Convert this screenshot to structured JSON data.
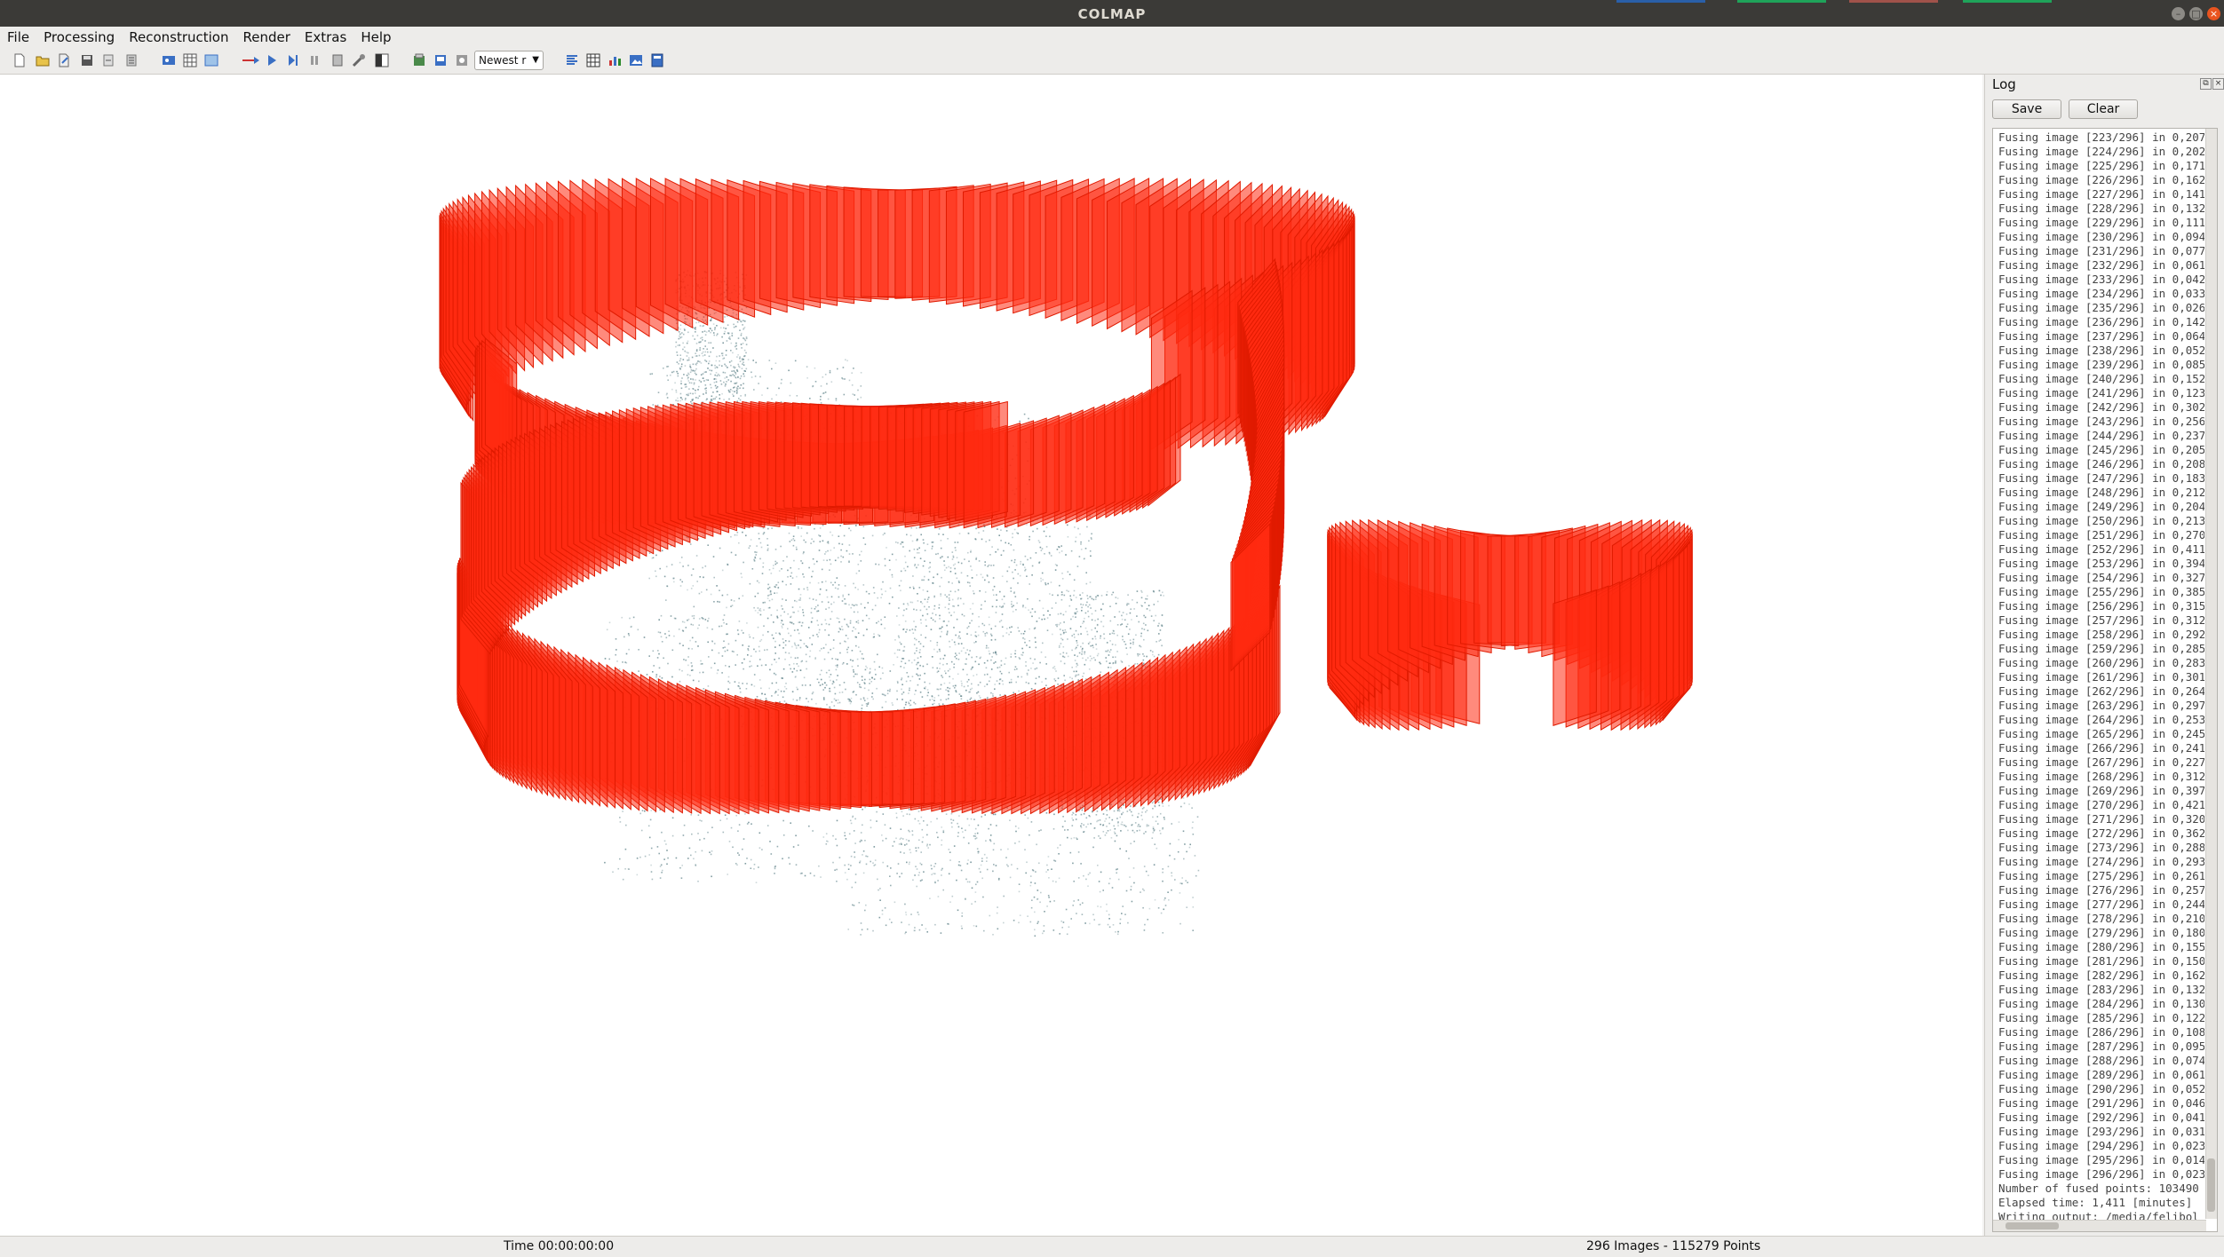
{
  "window": {
    "title": "COLMAP",
    "controls": [
      "minimize-icon",
      "maximize-icon",
      "close-icon"
    ]
  },
  "menu": [
    "File",
    "Processing",
    "Reconstruction",
    "Render",
    "Extras",
    "Help"
  ],
  "toolbar": {
    "icons": [
      "new-project-icon",
      "open-project-icon",
      "edit-project-icon",
      "save-project-icon",
      "import-model-icon",
      "export-model-icon",
      "feature-extraction-icon",
      "feature-matching-icon",
      "database-icon",
      "reconstruction-start-icon",
      "play-icon",
      "step-icon",
      "pause-icon",
      "reset-icon",
      "bundle-adjustment-icon",
      "dense-icon",
      "render-options-icon",
      "reconstruction-stats-icon",
      "match-matrix-icon"
    ],
    "reconstruction_select": "Newest r",
    "right_icons": [
      "log-icon",
      "grid-icon",
      "chart-icon",
      "image-icon",
      "window-icon"
    ]
  },
  "log": {
    "title": "Log",
    "save_label": "Save",
    "clear_label": "Clear",
    "lines": [
      "Fusing image [223/296] in 0,207",
      "Fusing image [224/296] in 0,202",
      "Fusing image [225/296] in 0,171",
      "Fusing image [226/296] in 0,162",
      "Fusing image [227/296] in 0,141",
      "Fusing image [228/296] in 0,132",
      "Fusing image [229/296] in 0,111",
      "Fusing image [230/296] in 0,094",
      "Fusing image [231/296] in 0,077",
      "Fusing image [232/296] in 0,061",
      "Fusing image [233/296] in 0,042",
      "Fusing image [234/296] in 0,033",
      "Fusing image [235/296] in 0,026",
      "Fusing image [236/296] in 0,142",
      "Fusing image [237/296] in 0,064",
      "Fusing image [238/296] in 0,052",
      "Fusing image [239/296] in 0,085",
      "Fusing image [240/296] in 0,152",
      "Fusing image [241/296] in 0,123",
      "Fusing image [242/296] in 0,302",
      "Fusing image [243/296] in 0,256",
      "Fusing image [244/296] in 0,237",
      "Fusing image [245/296] in 0,205",
      "Fusing image [246/296] in 0,208",
      "Fusing image [247/296] in 0,183",
      "Fusing image [248/296] in 0,212",
      "Fusing image [249/296] in 0,204",
      "Fusing image [250/296] in 0,213",
      "Fusing image [251/296] in 0,270",
      "Fusing image [252/296] in 0,411",
      "Fusing image [253/296] in 0,394",
      "Fusing image [254/296] in 0,327",
      "Fusing image [255/296] in 0,385",
      "Fusing image [256/296] in 0,315",
      "Fusing image [257/296] in 0,312",
      "Fusing image [258/296] in 0,292",
      "Fusing image [259/296] in 0,285",
      "Fusing image [260/296] in 0,283",
      "Fusing image [261/296] in 0,301",
      "Fusing image [262/296] in 0,264",
      "Fusing image [263/296] in 0,297",
      "Fusing image [264/296] in 0,253",
      "Fusing image [265/296] in 0,245",
      "Fusing image [266/296] in 0,241",
      "Fusing image [267/296] in 0,227",
      "Fusing image [268/296] in 0,312",
      "Fusing image [269/296] in 0,397",
      "Fusing image [270/296] in 0,421",
      "Fusing image [271/296] in 0,320",
      "Fusing image [272/296] in 0,362",
      "Fusing image [273/296] in 0,288",
      "Fusing image [274/296] in 0,293",
      "Fusing image [275/296] in 0,261",
      "Fusing image [276/296] in 0,257",
      "Fusing image [277/296] in 0,244",
      "Fusing image [278/296] in 0,210",
      "Fusing image [279/296] in 0,180",
      "Fusing image [280/296] in 0,155",
      "Fusing image [281/296] in 0,150",
      "Fusing image [282/296] in 0,162",
      "Fusing image [283/296] in 0,132",
      "Fusing image [284/296] in 0,130",
      "Fusing image [285/296] in 0,122",
      "Fusing image [286/296] in 0,108",
      "Fusing image [287/296] in 0,095",
      "Fusing image [288/296] in 0,074",
      "Fusing image [289/296] in 0,061",
      "Fusing image [290/296] in 0,052",
      "Fusing image [291/296] in 0,046",
      "Fusing image [292/296] in 0,041",
      "Fusing image [293/296] in 0,031",
      "Fusing image [294/296] in 0,023",
      "Fusing image [295/296] in 0,014",
      "Fusing image [296/296] in 0,023",
      "Number of fused points: 103490",
      "Elapsed time: 1,411 [minutes]",
      "Writing output: /media/felibol"
    ]
  },
  "status": {
    "time": "Time 00:00:00:00",
    "stats": "296 Images - 115279 Points"
  },
  "colors": {
    "camera": "#ff2a10",
    "camera_edge": "#e01a00",
    "points": "#6e8e94",
    "titlebar": "#3b3a37"
  }
}
